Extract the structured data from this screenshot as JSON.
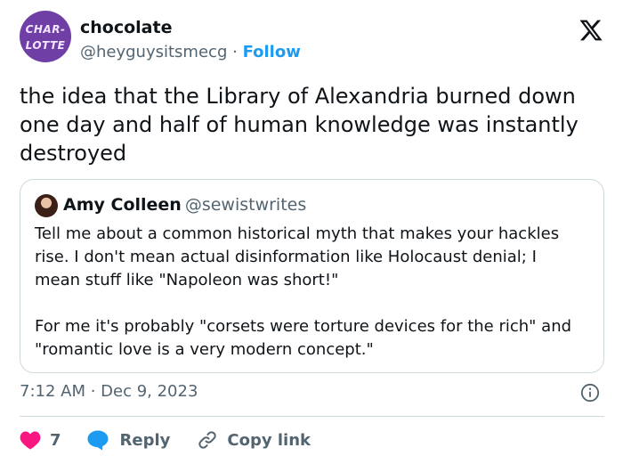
{
  "author": {
    "avatar_text": [
      "CHAR-",
      "LOTTE"
    ],
    "name": "chocolate",
    "handle": "@heyguysitsmecg",
    "separator": "·",
    "follow_label": "Follow"
  },
  "tweet": {
    "text": "the idea that the Library of Alexandria burned down one day and half of human knowledge was instantly destroyed",
    "timestamp": "7:12 AM · Dec 9, 2023"
  },
  "quoted_tweet": {
    "name": "Amy Colleen",
    "handle": "@sewistwrites",
    "paragraphs": [
      "Tell me about a common historical myth that makes your hackles rise. I don't mean actual disinformation like Holocaust denial; I mean stuff like \"Napoleon was short!\"",
      "For me it's probably \"corsets were torture devices for the rich\" and \"romantic love is a very modern concept.\""
    ]
  },
  "actions": {
    "like_count": "7",
    "reply_label": "Reply",
    "copy_label": "Copy link"
  },
  "icons": {
    "logo": "x-logo-icon",
    "info": "info-icon",
    "like": "heart-icon",
    "reply": "speech-bubble-icon",
    "copy": "link-icon"
  },
  "colors": {
    "accent": "#1d9bf0",
    "like": "#f91880",
    "avatar": "#6f3fa6",
    "muted_text": "#536471",
    "border": "#cfd9de"
  }
}
